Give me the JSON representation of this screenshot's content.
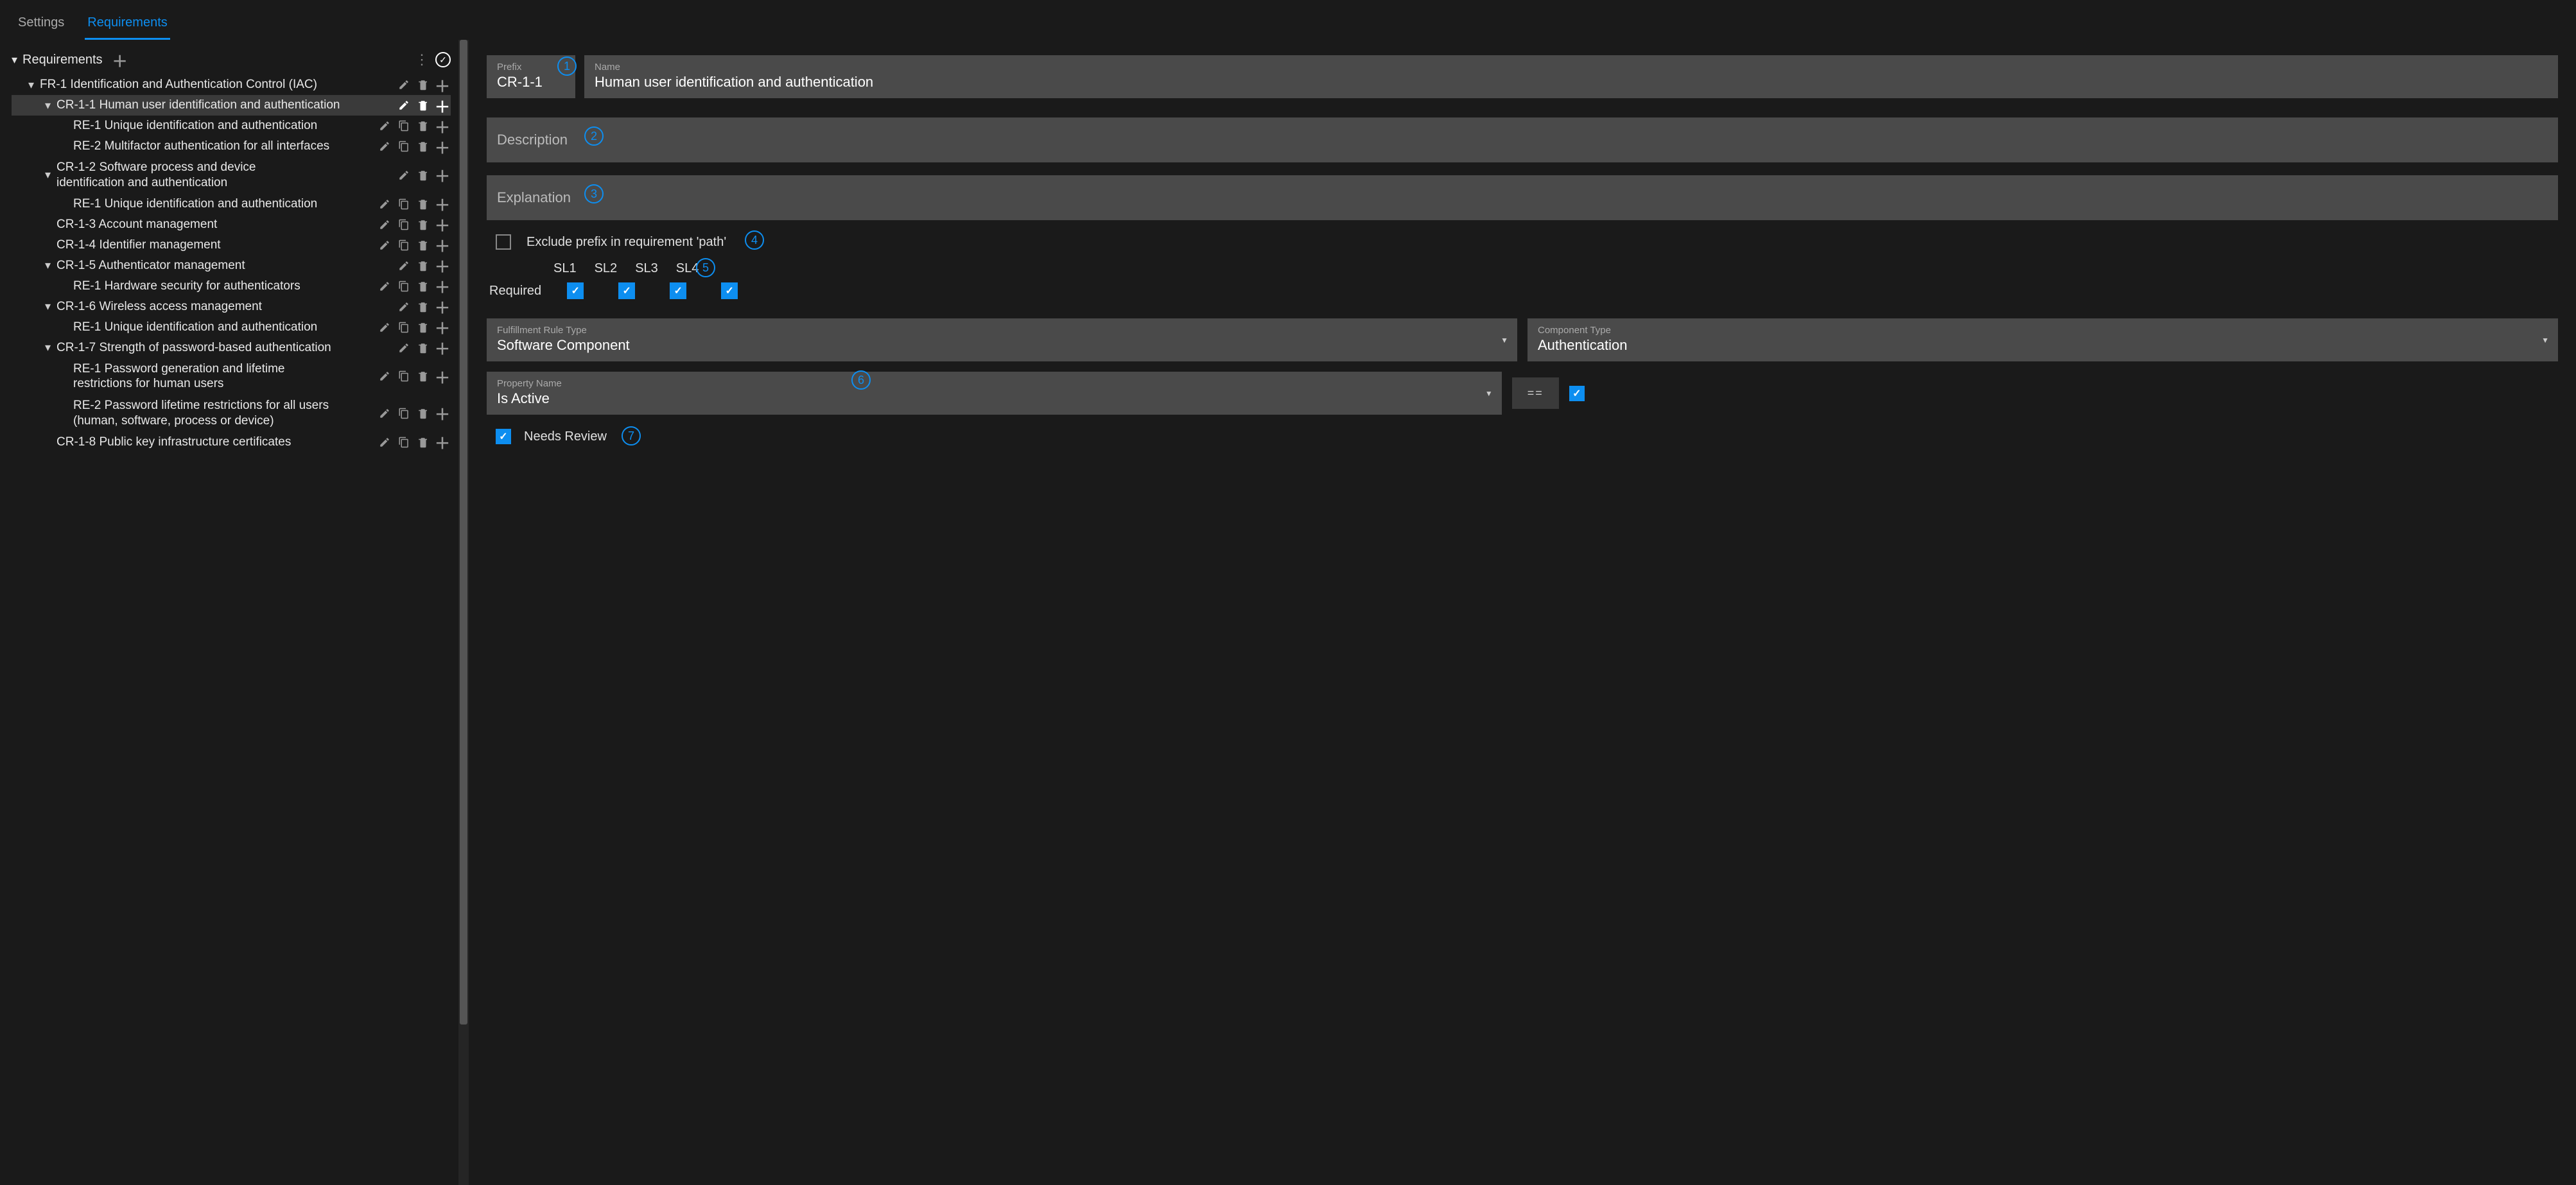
{
  "tabs": {
    "settings": "Settings",
    "requirements": "Requirements"
  },
  "tree_header": "Requirements",
  "tree": [
    {
      "exp": "v",
      "indent": 1,
      "label": "FR-1 Identification and Authentication Control (IAC)",
      "acts": [
        "edit",
        "delete",
        "add"
      ]
    },
    {
      "exp": "v",
      "indent": 2,
      "label": "CR-1-1 Human user identification and authentication",
      "acts": [
        "edit",
        "delete",
        "add"
      ],
      "selected": true
    },
    {
      "exp": "",
      "indent": 3,
      "label": "RE-1 Unique identification and authentication",
      "acts": [
        "edit",
        "copy",
        "delete",
        "add"
      ]
    },
    {
      "exp": "",
      "indent": 3,
      "label": "RE-2 Multifactor authentication for all interfaces",
      "acts": [
        "edit",
        "copy",
        "delete",
        "add"
      ]
    },
    {
      "exp": "v",
      "indent": 2,
      "label": "CR-1-2 Software process and device identification and authentication",
      "acts": [
        "edit",
        "delete",
        "add"
      ],
      "two": true
    },
    {
      "exp": "",
      "indent": 3,
      "label": "RE-1 Unique identification and authentication",
      "acts": [
        "edit",
        "copy",
        "delete",
        "add"
      ]
    },
    {
      "exp": "",
      "indent": 2,
      "label": "CR-1-3 Account management",
      "acts": [
        "edit",
        "copy",
        "delete",
        "add"
      ]
    },
    {
      "exp": "",
      "indent": 2,
      "label": "CR-1-4 Identifier management",
      "acts": [
        "edit",
        "copy",
        "delete",
        "add"
      ]
    },
    {
      "exp": "v",
      "indent": 2,
      "label": "CR-1-5 Authenticator management",
      "acts": [
        "edit",
        "delete",
        "add"
      ]
    },
    {
      "exp": "",
      "indent": 3,
      "label": "RE-1 Hardware security for authenticators",
      "acts": [
        "edit",
        "copy",
        "delete",
        "add"
      ]
    },
    {
      "exp": "v",
      "indent": 2,
      "label": "CR-1-6 Wireless access management",
      "acts": [
        "edit",
        "delete",
        "add"
      ]
    },
    {
      "exp": "",
      "indent": 3,
      "label": "RE-1 Unique identification and authentication",
      "acts": [
        "edit",
        "copy",
        "delete",
        "add"
      ]
    },
    {
      "exp": "v",
      "indent": 2,
      "label": "CR-1-7 Strength of password-based authentication",
      "acts": [
        "edit",
        "delete",
        "add"
      ]
    },
    {
      "exp": "",
      "indent": 3,
      "label": "RE-1 Password generation and lifetime restrictions for human users",
      "acts": [
        "edit",
        "copy",
        "delete",
        "add"
      ],
      "two": true
    },
    {
      "exp": "",
      "indent": 3,
      "label": "RE-2 Password lifetime restrictions for all users (human, software, process or device)",
      "acts": [
        "edit",
        "copy",
        "delete",
        "add"
      ],
      "two": true
    },
    {
      "exp": "",
      "indent": 2,
      "label": "CR-1-8 Public key infrastructure certificates",
      "acts": [
        "edit",
        "copy",
        "delete",
        "add"
      ]
    }
  ],
  "detail": {
    "prefix_label": "Prefix",
    "prefix_value": "CR-1-1",
    "name_label": "Name",
    "name_value": "Human user identification and authentication",
    "desc_label": "Description",
    "expl_label": "Explanation",
    "exclude_label": "Exclude prefix in requirement 'path'",
    "sl": [
      "SL1",
      "SL2",
      "SL3",
      "SL4"
    ],
    "required_label": "Required",
    "required": [
      true,
      true,
      true,
      true
    ],
    "frt_label": "Fulfillment Rule Type",
    "frt_value": "Software Component",
    "ct_label": "Component Type",
    "ct_value": "Authentication",
    "pn_label": "Property Name",
    "pn_value": "Is Active",
    "eq": "==",
    "needs_review": "Needs Review"
  },
  "ann": {
    "1": "1",
    "2": "2",
    "3": "3",
    "4": "4",
    "5": "5",
    "6": "6",
    "7": "7"
  }
}
